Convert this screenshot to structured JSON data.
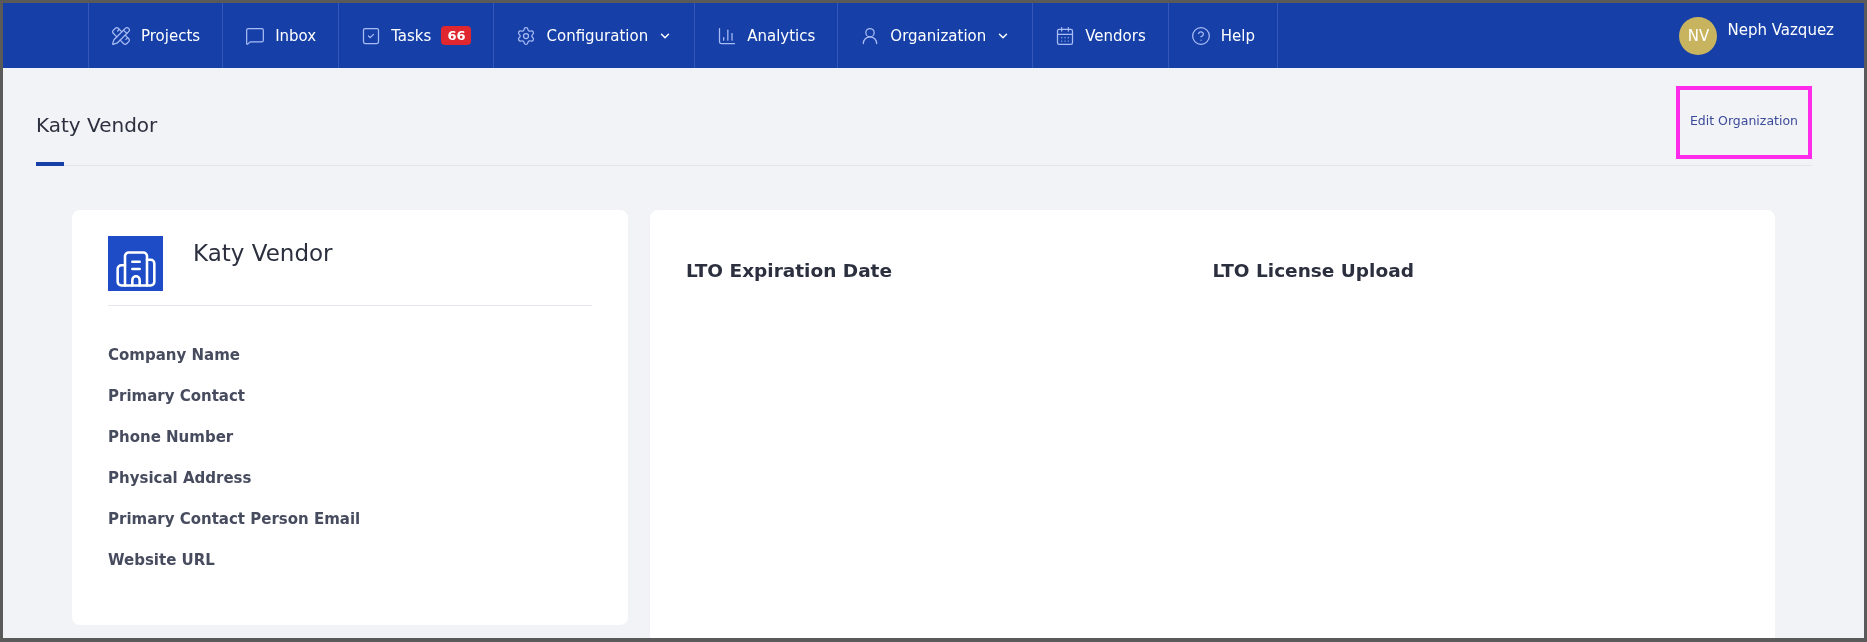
{
  "nav_items": [
    {
      "label": "Projects",
      "dropdown": false
    },
    {
      "label": "Inbox",
      "dropdown": false
    },
    {
      "label": "Tasks",
      "badge": "66",
      "dropdown": false
    },
    {
      "label": "Configuration",
      "dropdown": true
    },
    {
      "label": "Analytics",
      "dropdown": false
    },
    {
      "label": "Organization",
      "dropdown": true
    },
    {
      "label": "Vendors",
      "dropdown": false
    },
    {
      "label": "Help",
      "dropdown": false
    }
  ],
  "user": {
    "initials": "NV",
    "name": "Neph Vazquez"
  },
  "page": {
    "title": "Katy Vendor",
    "action": {
      "label": "Edit Organization",
      "highlighted": true
    }
  },
  "profile_card": {
    "name": "Katy Vendor",
    "fields": [
      "Company Name",
      "Primary Contact",
      "Phone Number",
      "Physical Address",
      "Primary Contact Person Email",
      "Website URL"
    ]
  },
  "details_card": {
    "headings": [
      "LTO Expiration Date",
      "LTO License Upload"
    ]
  }
}
